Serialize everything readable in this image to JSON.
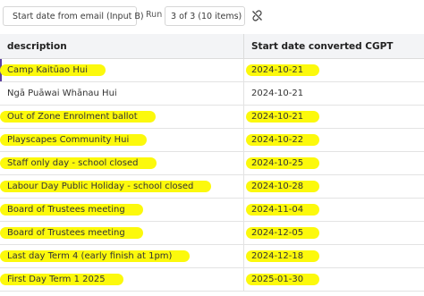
{
  "toolbar": {
    "input_label": "Start date from email (Input B)",
    "run_label": "Run",
    "run_value": "3 of 3 (10 items)",
    "icons": {
      "edit": "pencil-icon",
      "dropdown": "chevron-down-icon",
      "unlink": "unlink-icon"
    },
    "accent_color": "#5b3fa0"
  },
  "table": {
    "columns": [
      "description",
      "Start date converted CGPT"
    ],
    "highlight_color": "#fcf90c",
    "rows": [
      {
        "description": "Camp Kaitūao Hui",
        "date": "2024-10-21",
        "highlighted": true
      },
      {
        "description": "Ngā Puāwai Whānau Hui",
        "date": "2024-10-21",
        "highlighted": false
      },
      {
        "description": "Out of Zone Enrolment ballot",
        "date": "2024-10-21",
        "highlighted": true
      },
      {
        "description": "Playscapes Community Hui",
        "date": "2024-10-22",
        "highlighted": true
      },
      {
        "description": "Staff only day - school closed",
        "date": "2024-10-25",
        "highlighted": true
      },
      {
        "description": "Labour Day Public Holiday - school closed",
        "date": "2024-10-28",
        "highlighted": true
      },
      {
        "description": "Board of Trustees meeting",
        "date": "2024-11-04",
        "highlighted": true
      },
      {
        "description": "Board of Trustees meeting",
        "date": "2024-12-05",
        "highlighted": true
      },
      {
        "description": "Last day Term 4 (early finish at 1pm)",
        "date": "2024-12-18",
        "highlighted": true
      },
      {
        "description": "First Day Term 1 2025",
        "date": "2025-01-30",
        "highlighted": true
      }
    ]
  }
}
